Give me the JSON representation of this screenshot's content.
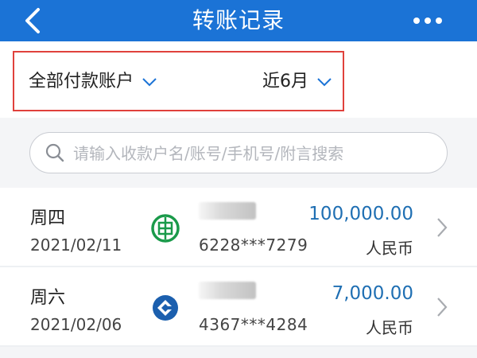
{
  "header": {
    "title": "转账记录",
    "back_icon": "chevron-left-icon",
    "more_icon": "more-dots-icon",
    "bg_color": "#1b73d6"
  },
  "filters": {
    "account_label": "全部付款账户",
    "period_label": "近6月",
    "highlight_color": "#e0413c"
  },
  "search": {
    "placeholder": "请输入收款户名/账号/手机号/附言搜索",
    "value": ""
  },
  "records": [
    {
      "weekday": "周四",
      "date": "2021/02/11",
      "bank_icon": "abc-bank-icon",
      "account_masked": "6228***7279",
      "amount": "100,000.00",
      "currency": "人民币"
    },
    {
      "weekday": "周六",
      "date": "2021/02/06",
      "bank_icon": "ccb-bank-icon",
      "account_masked": "4367***4284",
      "amount": "7,000.00",
      "currency": "人民币"
    }
  ],
  "colors": {
    "amount": "#1f6fb3",
    "abc_green": "#1a9a4a",
    "ccb_blue": "#1b5fae"
  }
}
